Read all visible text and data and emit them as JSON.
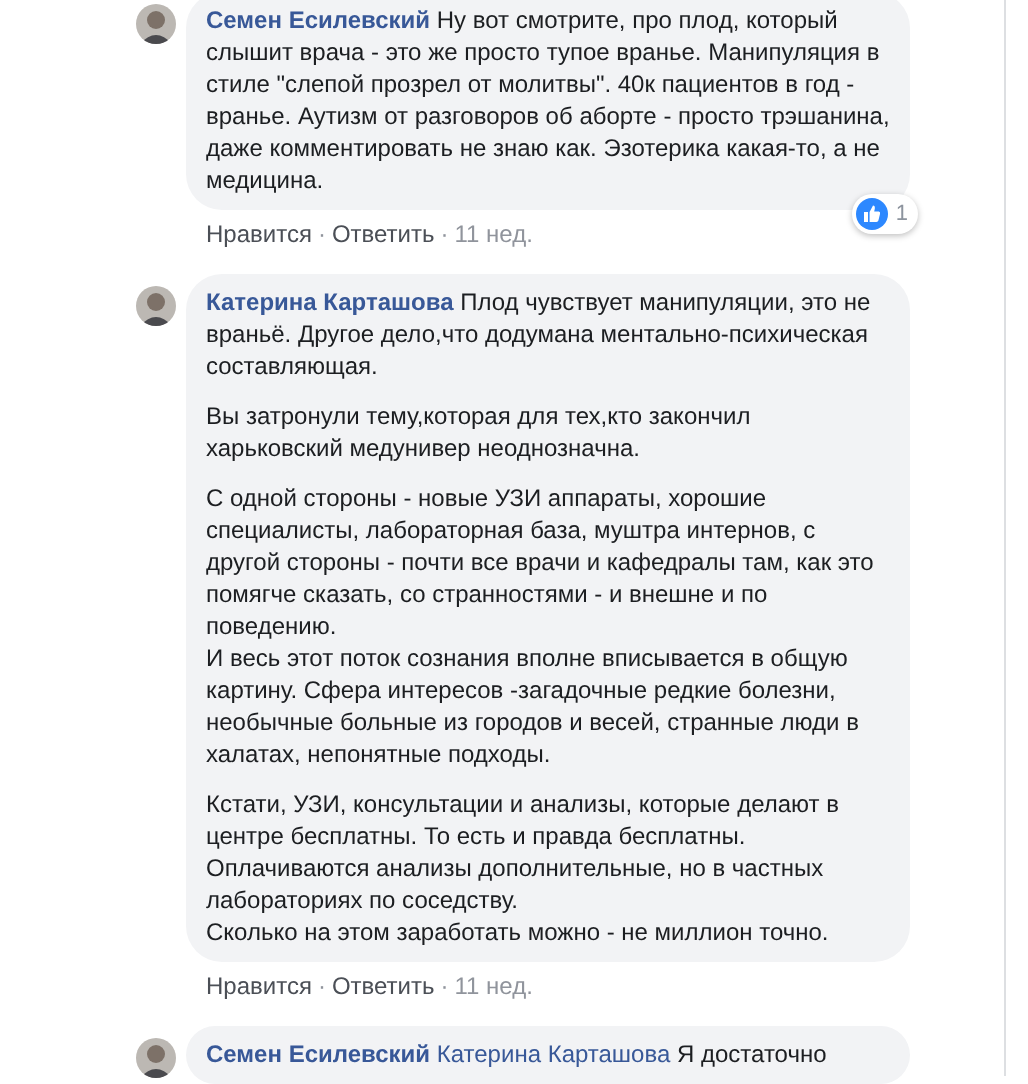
{
  "comments": [
    {
      "author": "Семен Есилевский",
      "paragraphs": [
        [
          "Ну вот смотрите, про плод, который слышит врача - это же просто тупое вранье. Манипуляция в стиле \"слепой прозрел от молитвы\". 40к пациентов в год - вранье. Аутизм от разговоров об аборте - просто трэшанина, даже комментировать не знаю как. Эзотерика какая-то, а не медицина."
        ]
      ],
      "reactions": "1",
      "actions": [
        {
          "kind": "link",
          "text": "Нравится"
        },
        {
          "kind": "separator",
          "text": "·"
        },
        {
          "kind": "link",
          "text": "Ответить"
        },
        {
          "kind": "separator",
          "text": "·"
        },
        {
          "kind": "time",
          "text": "11 нед."
        }
      ]
    },
    {
      "author": "Катерина Карташова",
      "paragraphs": [
        [
          "Плод чувствует манипуляции, это не враньё. Другое дело,что додумана ментально-психическая составляющая."
        ],
        [
          "Вы затронули тему,которая для тех,кто закончил харьковский медунивер неоднозначна."
        ],
        [
          "С одной стороны - новые УЗИ аппараты, хорошие специалисты, лабораторная база, муштра интернов, с другой стороны - почти все врачи и кафедралы там, как это помягче сказать, со странностями - и внешне и по поведению.",
          "И весь этот поток сознания вполне вписывается в общую картину. Сфера интересов -загадочные редкие болезни, необычные больные из городов и весей, странные люди в халатах, непонятные подходы."
        ],
        [
          "Кстати, УЗИ, консультации и анализы, которые делают в центре бесплатны. То есть и правда бесплатны.",
          "Оплачиваются анализы дополнительные, но в частных лабораториях по соседству.",
          "Сколько на этом заработать можно - не миллион точно."
        ]
      ],
      "actions": [
        {
          "kind": "link",
          "text": "Нравится"
        },
        {
          "kind": "separator",
          "text": "·"
        },
        {
          "kind": "link",
          "text": "Ответить"
        },
        {
          "kind": "separator",
          "text": "·"
        },
        {
          "kind": "time",
          "text": "11 нед."
        }
      ]
    },
    {
      "author": "Семен Есилевский",
      "mention": "Катерина Карташова",
      "paragraphs": [
        [
          "Я достаточно"
        ]
      ]
    }
  ]
}
